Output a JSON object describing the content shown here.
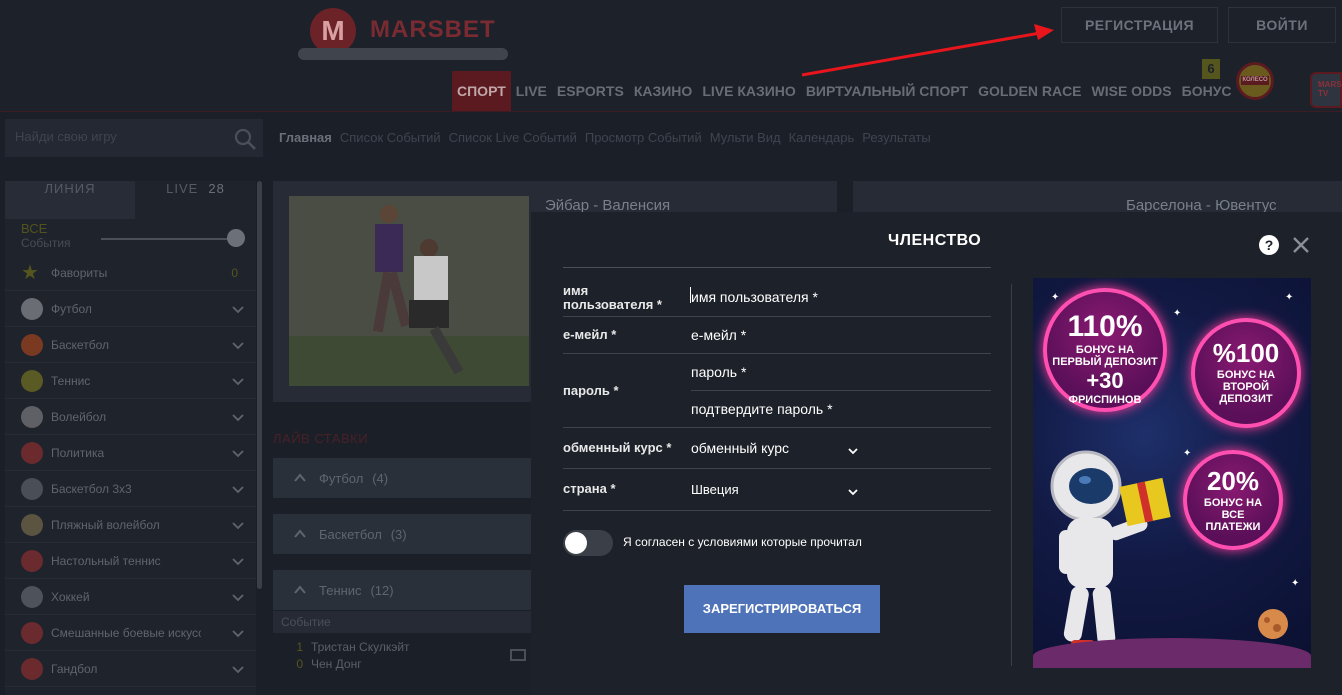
{
  "header": {
    "logo_text": "MARSBET",
    "logo_mark": "M",
    "register_label": "РЕГИСТРАЦИЯ",
    "login_label": "ВОЙТИ",
    "nav": [
      "СПОРТ",
      "LIVE",
      "ESPORTS",
      "КАЗИНО",
      "LIVE КАЗИНО",
      "ВИРТУАЛЬНЫЙ СПОРТ",
      "GOLDEN RACE",
      "WISE ODDS",
      "БОНУС"
    ],
    "bonus_count": "6",
    "wheel_label": "КОЛЕСО",
    "tv_label": "MARS TV"
  },
  "search": {
    "placeholder": "Найди свою игру"
  },
  "breadcrumb": [
    "Главная",
    "Список Событий",
    "Список Live Событий",
    "Просмотр Событий",
    "Мульти Вид",
    "Календарь",
    "Результаты"
  ],
  "sidebar": {
    "tab_line": "ЛИНИЯ",
    "tab_live": "LIVE",
    "live_count": "28",
    "events_all": "ВСЕ",
    "events_label": "События",
    "items": [
      {
        "label": "Фавориты",
        "icon": "star-icon",
        "color": "#55561e",
        "count": "0"
      },
      {
        "label": "Футбол",
        "icon": "football-icon",
        "color": "#6a6e74"
      },
      {
        "label": "Баскетбол",
        "icon": "basketball-icon",
        "color": "#7a3a22"
      },
      {
        "label": "Теннис",
        "icon": "tennis-icon",
        "color": "#5a5a24"
      },
      {
        "label": "Волейбол",
        "icon": "volleyball-icon",
        "color": "#5e6066"
      },
      {
        "label": "Политика",
        "icon": "megaphone-icon",
        "color": "#6a2a2e"
      },
      {
        "label": "Баскетбол 3x3",
        "icon": "basketball-3x3-icon",
        "color": "#4a4e56"
      },
      {
        "label": "Пляжный волейбол",
        "icon": "beach-volleyball-icon",
        "color": "#5a5440"
      },
      {
        "label": "Настольный теннис",
        "icon": "table-tennis-icon",
        "color": "#6a2a2e"
      },
      {
        "label": "Хоккей",
        "icon": "hockey-icon",
        "color": "#4e525a"
      },
      {
        "label": "Смешанные боевые искусства",
        "icon": "mma-icon",
        "color": "#6a2a2e"
      },
      {
        "label": "Гандбол",
        "icon": "handball-icon",
        "color": "#6a2a2e"
      }
    ]
  },
  "content": {
    "match1_title": "Эйбар - Валенсия",
    "match2_title": "Барселона - Ювентус",
    "live_bets": "ЛАЙВ СТАВКИ",
    "accordions": [
      {
        "label": "Футбол",
        "count": "(4)"
      },
      {
        "label": "Баскетбол",
        "count": "(3)"
      },
      {
        "label": "Теннис",
        "count": "(12)"
      }
    ],
    "event_head": "Событие",
    "event_lines": [
      {
        "num": "1",
        "name": "Тристан Скулкэйт"
      },
      {
        "num": "0",
        "name": "Чен Донг"
      }
    ]
  },
  "modal": {
    "title": "ЧЛЕНСТВО",
    "help": "?",
    "fields": {
      "username_label_1": "имя",
      "username_label_2": "пользователя *",
      "username_value": "имя пользователя *",
      "email_label": "е-мейл *",
      "email_value": "е-мейл *",
      "password_label": "пароль *",
      "password_value": "пароль *",
      "confirm_value": "подтвердите пароль *",
      "currency_label": "обменный курс *",
      "currency_value": "обменный курс",
      "country_label": "страна *",
      "country_value": "Швеция"
    },
    "agree_text": "Я согласен с условиями которые прочитал",
    "submit_label": "ЗАРЕГИСТРИРОВАТЬСЯ",
    "promo": {
      "b1_big": "110%",
      "b1_l1": "БОНУС НА",
      "b1_l2": "ПЕРВЫЙ ДЕПОЗИТ",
      "b1_l3": "+30",
      "b1_l4": "ФРИСПИНОВ",
      "b2_big": "%100",
      "b2_l1": "БОНУС НА",
      "b2_l2": "ВТОРОЙ",
      "b2_l3": "ДЕПОЗИТ",
      "b3_big": "20%",
      "b3_l1": "БОНУС НА",
      "b3_l2": "ВСЕ",
      "b3_l3": "ПЛАТЕЖИ"
    }
  },
  "colors": {
    "accent_red": "#5a1a20",
    "submit_blue": "#4e73b8",
    "annotation_red": "#e8161c"
  }
}
